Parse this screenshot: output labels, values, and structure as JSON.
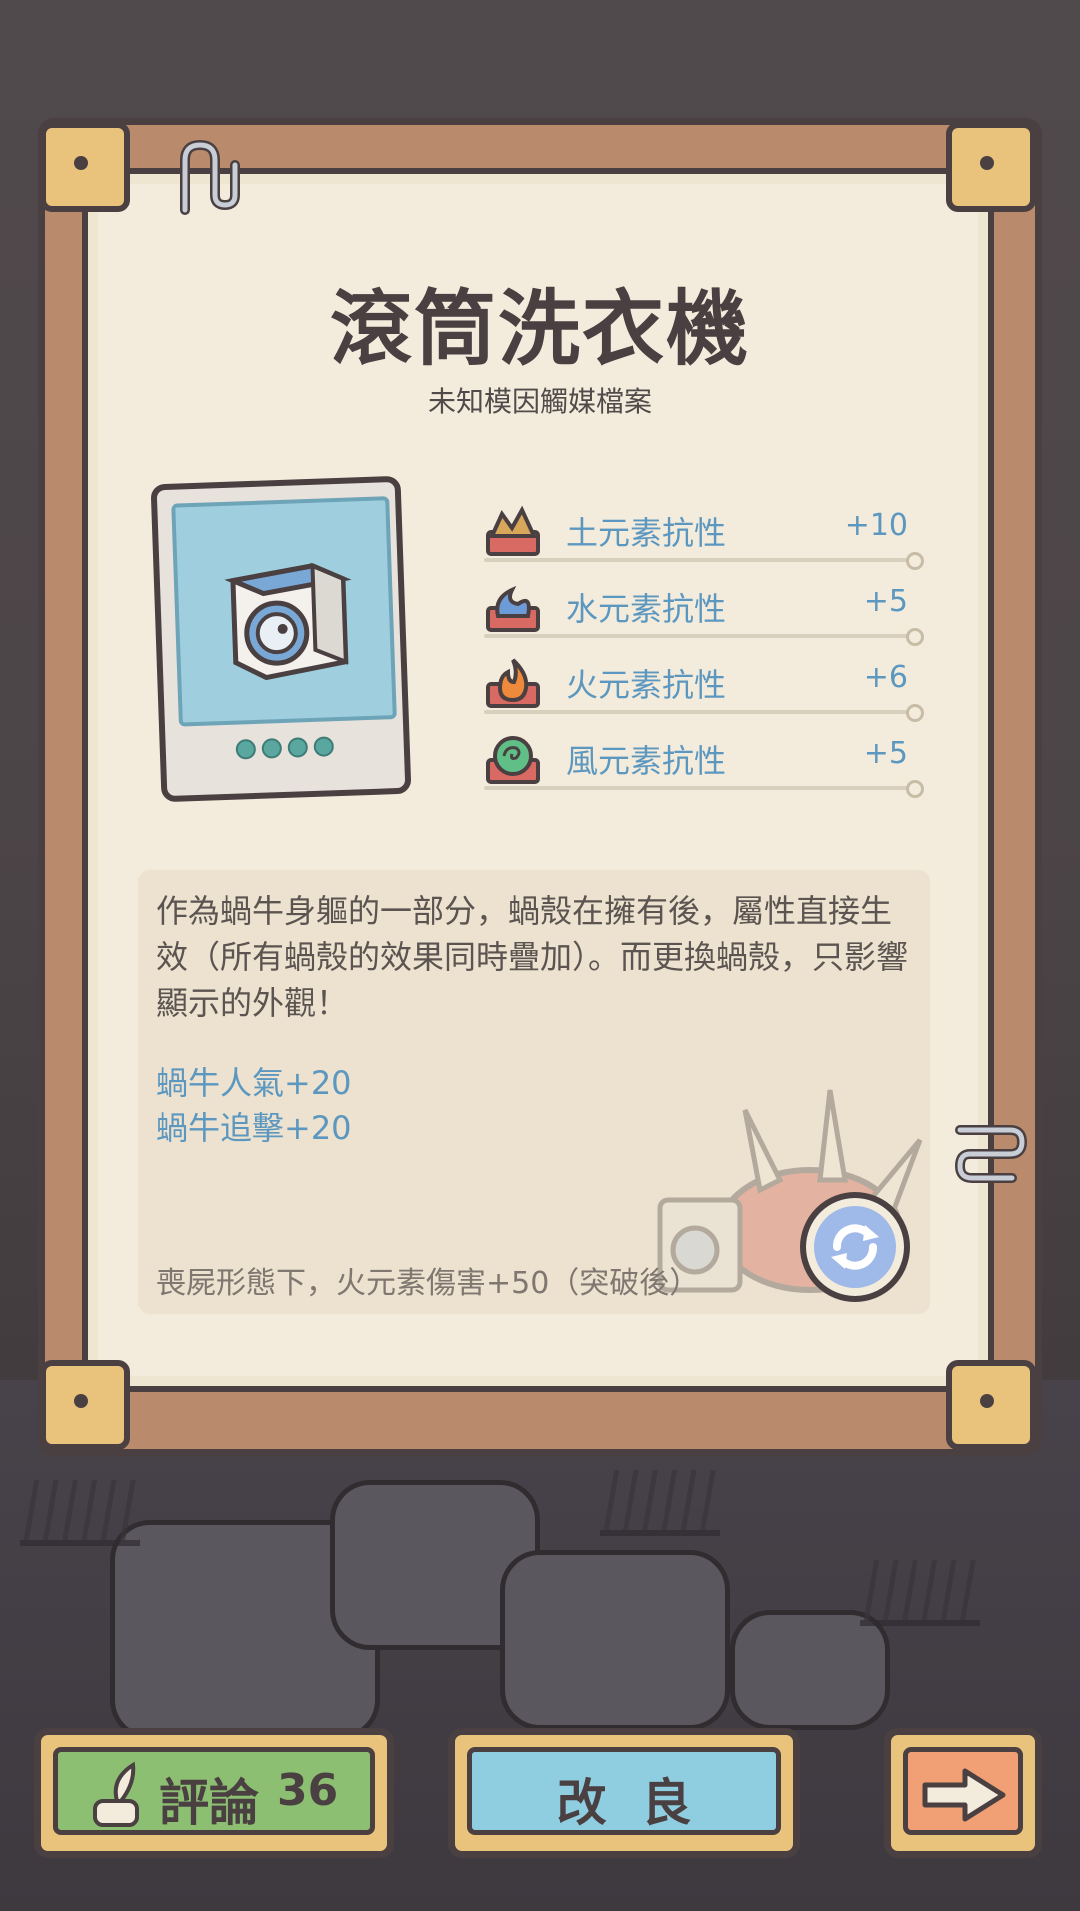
{
  "item": {
    "title": "滾筒洗衣機",
    "subtitle": "未知模因觸媒檔案",
    "page_dots": 4
  },
  "stats": [
    {
      "label": "土元素抗性",
      "value": "+10",
      "icon": "earth-element-icon",
      "color": "#d9a75a"
    },
    {
      "label": "水元素抗性",
      "value": "+5",
      "icon": "water-element-icon",
      "color": "#6c9bd8"
    },
    {
      "label": "火元素抗性",
      "value": "+6",
      "icon": "fire-element-icon",
      "color": "#ef8a3c"
    },
    {
      "label": "風元素抗性",
      "value": "+5",
      "icon": "wind-element-icon",
      "color": "#5fbf86"
    }
  ],
  "description": {
    "text": "作為蝸牛身軀的一部分，蝸殼在擁有後，屬性直接生效（所有蝸殼的效果同時疊加）。而更換蝸殼，只影響顯示的外觀！",
    "bonuses": [
      "蝸牛人氣+20",
      "蝸牛追擊+20"
    ],
    "zombie_note": "喪屍形態下，火元素傷害+50（突破後）"
  },
  "buttons": {
    "comment_label": "評論",
    "comment_count": "36",
    "improve_label": "改  良"
  },
  "colors": {
    "accent_blue": "#5c97c0",
    "frame": "#b98a6c",
    "paper": "#f3ecdc",
    "outline": "#4a4042",
    "green_button": "#8cbf72",
    "blue_button": "#8fcde0",
    "orange_button": "#f0a074"
  }
}
